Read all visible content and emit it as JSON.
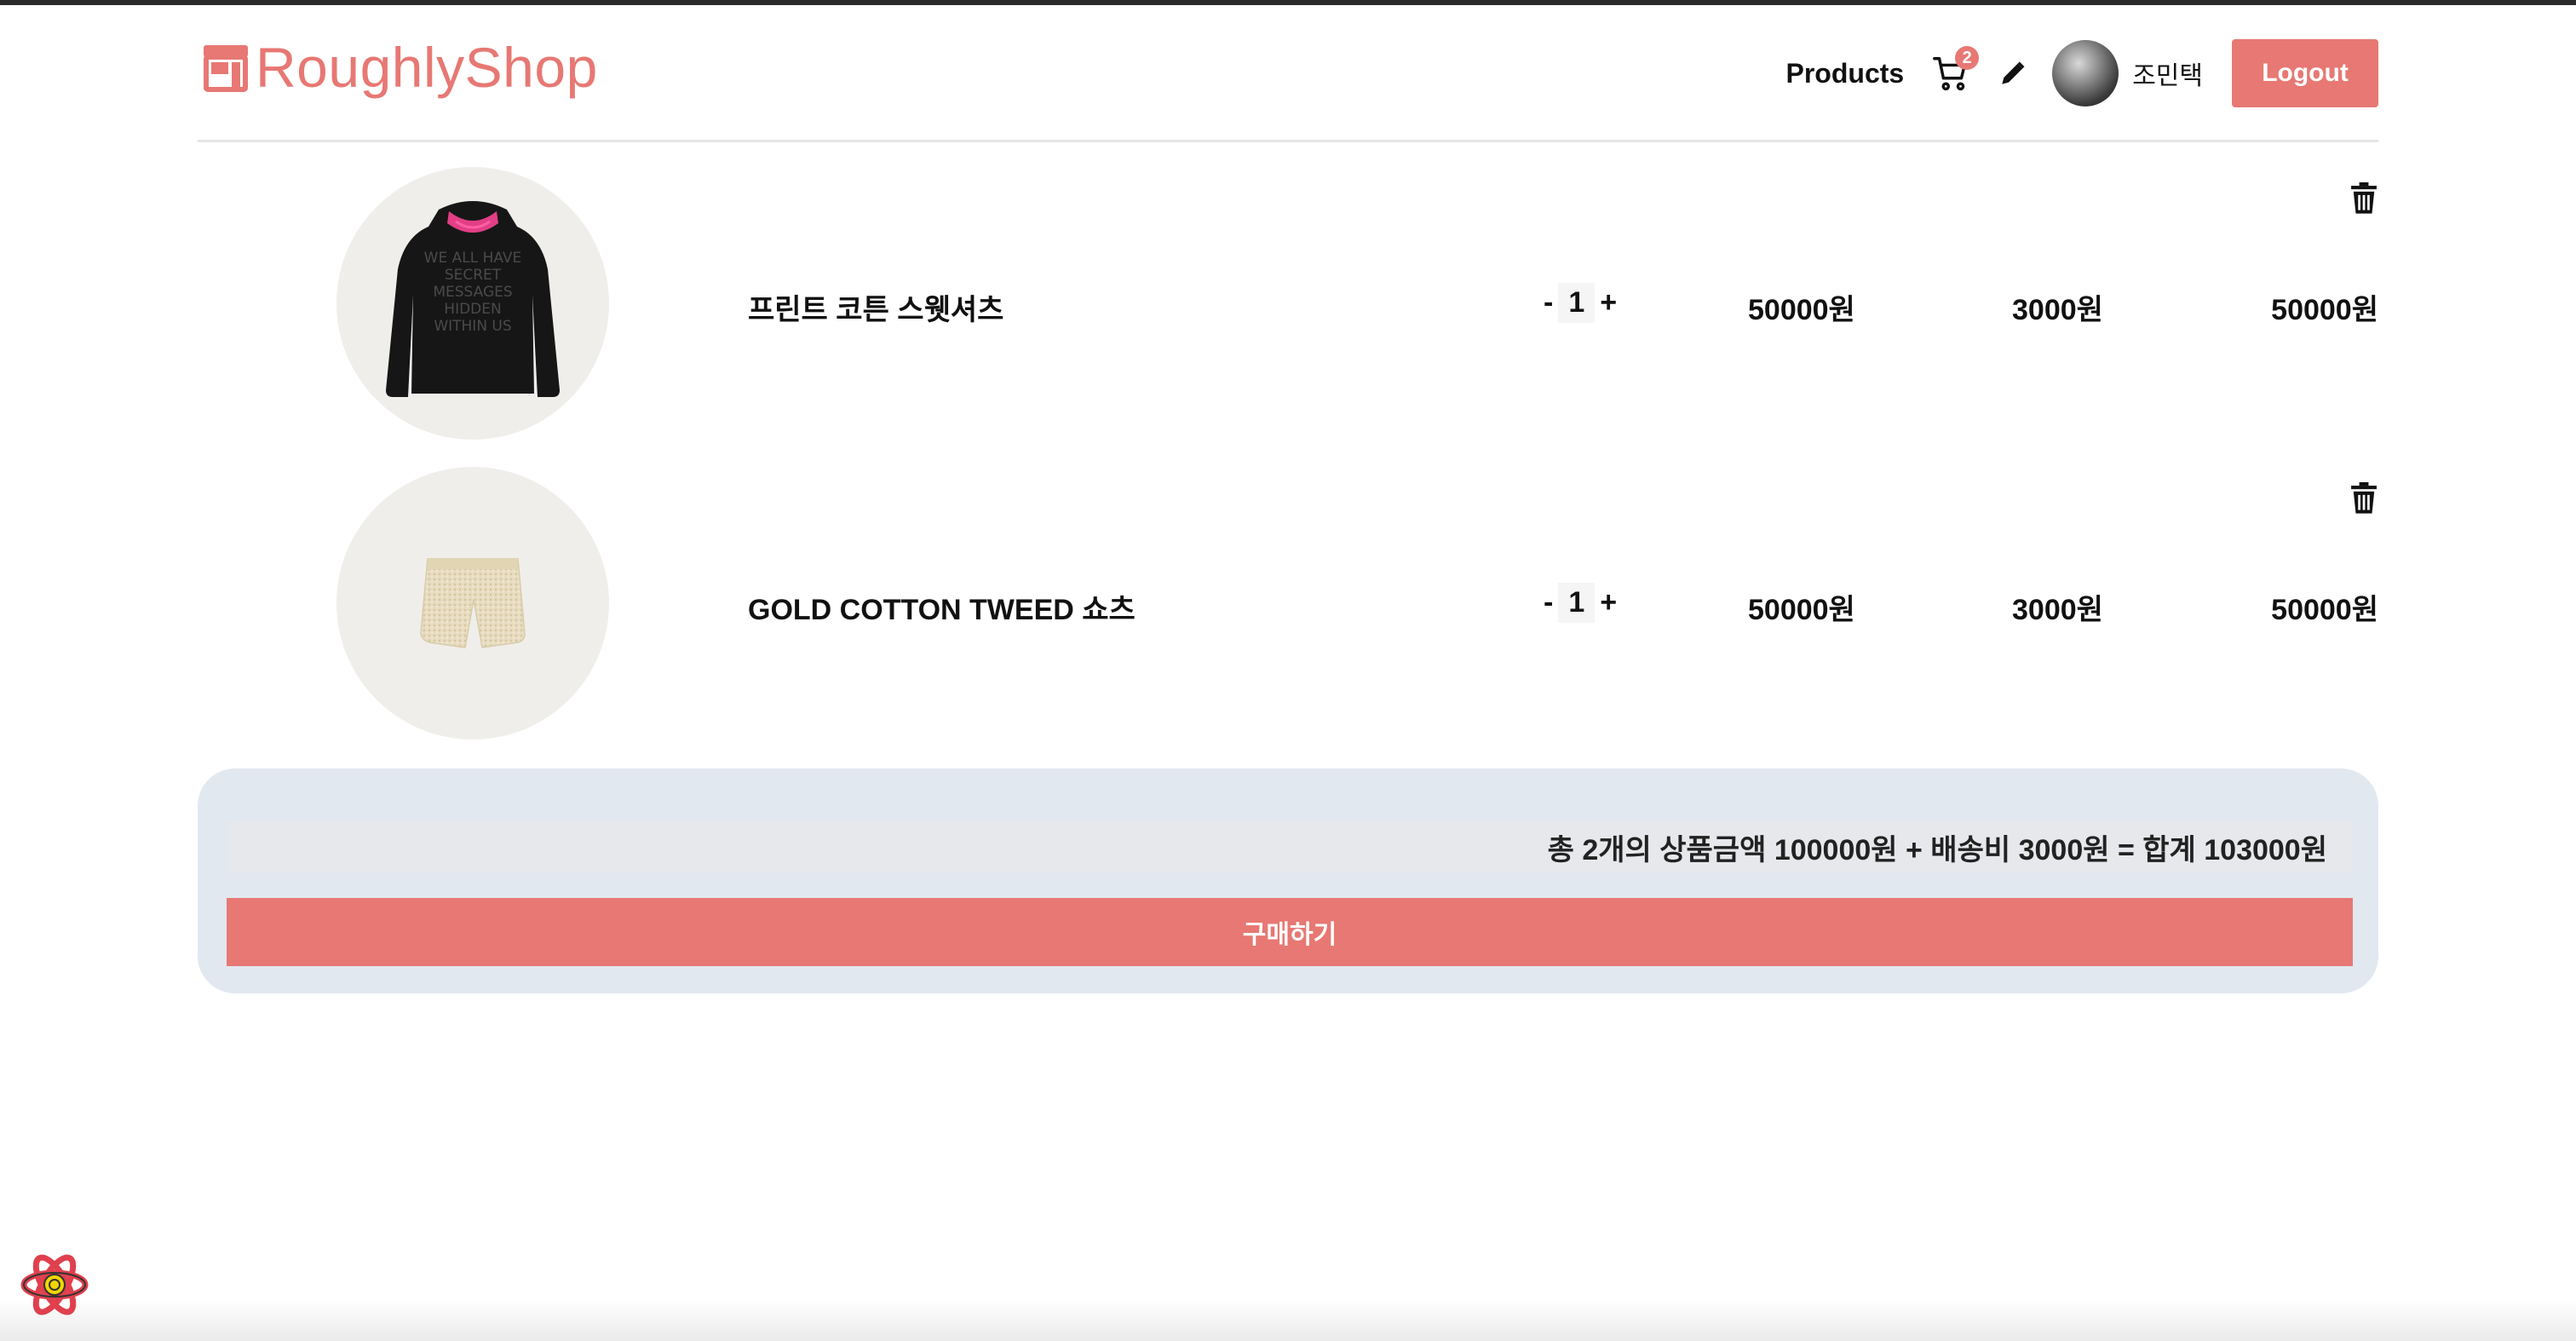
{
  "brand": {
    "name": "RoughlyShop",
    "color": "#e77873"
  },
  "nav": {
    "products_label": "Products",
    "cart_count": "2",
    "user_name": "조민택",
    "logout_label": "Logout"
  },
  "cart": {
    "items": [
      {
        "title": "프린트 코튼 스웻셔츠",
        "qty_minus": "-",
        "qty": "1",
        "qty_plus": "+",
        "price": "50000원",
        "shipping": "3000원",
        "total": "50000원",
        "image_icon": "hoodie-image",
        "print_lines": [
          "WE ALL HAVE",
          "SECRET",
          "MESSAGES",
          "HIDDEN",
          "WITHIN US"
        ]
      },
      {
        "title": "GOLD COTTON TWEED 쇼츠",
        "qty_minus": "-",
        "qty": "1",
        "qty_plus": "+",
        "price": "50000원",
        "shipping": "3000원",
        "total": "50000원",
        "image_icon": "shorts-image"
      }
    ]
  },
  "summary": {
    "text": "총 2개의 상품금액 100000원 + 배송비 3000원 = 합계 103000원",
    "buy_label": "구매하기"
  },
  "icons": {
    "cart": "cart-icon",
    "edit": "pencil-icon",
    "trash": "trash-icon",
    "logo": "store-icon",
    "devtools": "react-devtools-icon"
  }
}
